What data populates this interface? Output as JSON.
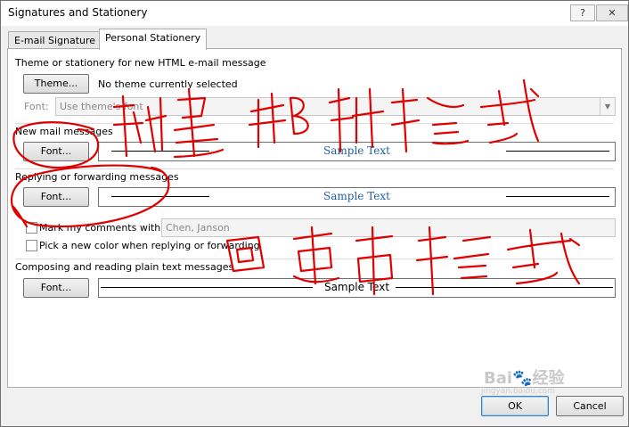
{
  "window": {
    "title": "Signatures and Stationery",
    "help_label": "?",
    "close_label": "✕"
  },
  "tabs": [
    {
      "label": "E-mail Signature"
    },
    {
      "label": "Personal Stationery"
    }
  ],
  "theme": {
    "heading": "Theme or stationery for new HTML e-mail message",
    "button_label": "Theme...",
    "status": "No theme currently selected",
    "font_label": "Font:",
    "font_value": "Use theme's font"
  },
  "new_mail": {
    "heading": "New mail messages",
    "button_label": "Font...",
    "sample": "Sample Text"
  },
  "reply": {
    "heading": "Replying or forwarding messages",
    "button_label": "Font...",
    "sample": "Sample Text",
    "mark_label": "Mark my comments with:",
    "mark_value": "Chen, Janson",
    "pick_color_label": "Pick a new color when replying or forwarding"
  },
  "plain": {
    "heading": "Composing and reading plain text messages",
    "button_label": "Font...",
    "sample": "Sample Text"
  },
  "footer": {
    "ok_label": "OK",
    "cancel_label": "Cancel"
  },
  "annotations": {
    "new_mail_note": "新建邮件格式",
    "reply_note": "回复邮件格式",
    "ink_color": "#e00000"
  },
  "watermark": {
    "brand": "Bai",
    "brand_suffix": "经验",
    "url": "jingyan.baidu.com"
  },
  "colors": {
    "sample_blue": "#1f5fa8",
    "panel_border": "#adadad"
  }
}
